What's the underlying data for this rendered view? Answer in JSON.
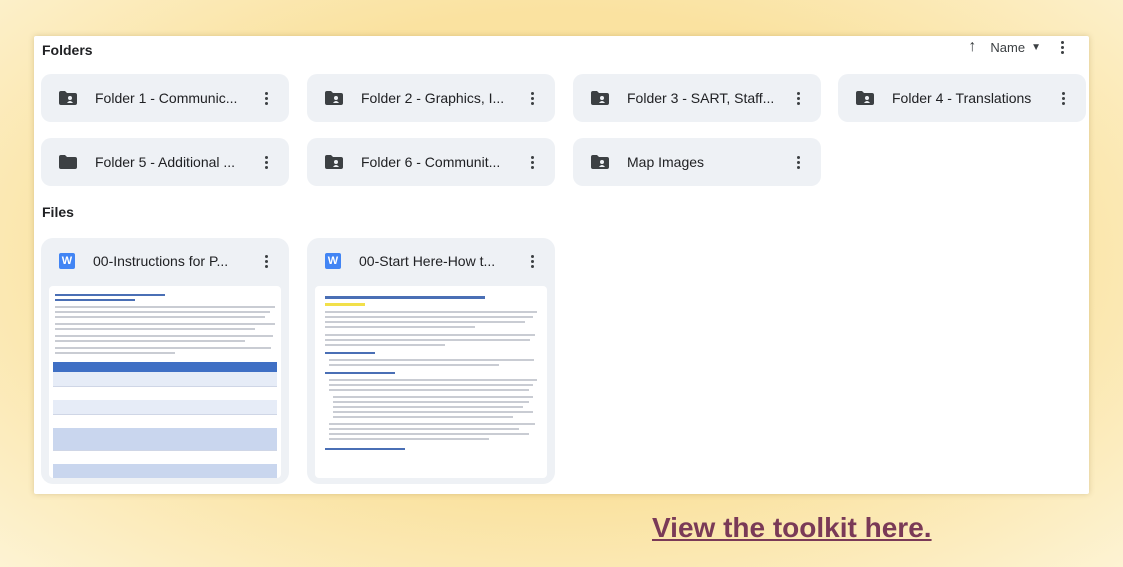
{
  "headers": {
    "folders_label": "Folders",
    "files_label": "Files"
  },
  "sort": {
    "label": "Name"
  },
  "folders": [
    {
      "name": "Folder 1 - Communic..."
    },
    {
      "name": "Folder 2 - Graphics, I..."
    },
    {
      "name": "Folder 3 - SART, Staff..."
    },
    {
      "name": "Folder 4 - Translations"
    },
    {
      "name": "Folder 5 - Additional ..."
    },
    {
      "name": "Folder 6 - Communit..."
    },
    {
      "name": "Map Images"
    }
  ],
  "files": [
    {
      "name": "00-Instructions for P...",
      "icon_letter": "W"
    },
    {
      "name": "00-Start Here-How t...",
      "icon_letter": "W"
    }
  ],
  "cta": {
    "label": "View the toolkit here."
  },
  "colors": {
    "background": "#fae2a0",
    "card": "#eef1f5",
    "doc_icon": "#4285f4",
    "cta_text": "#7a3a57"
  }
}
